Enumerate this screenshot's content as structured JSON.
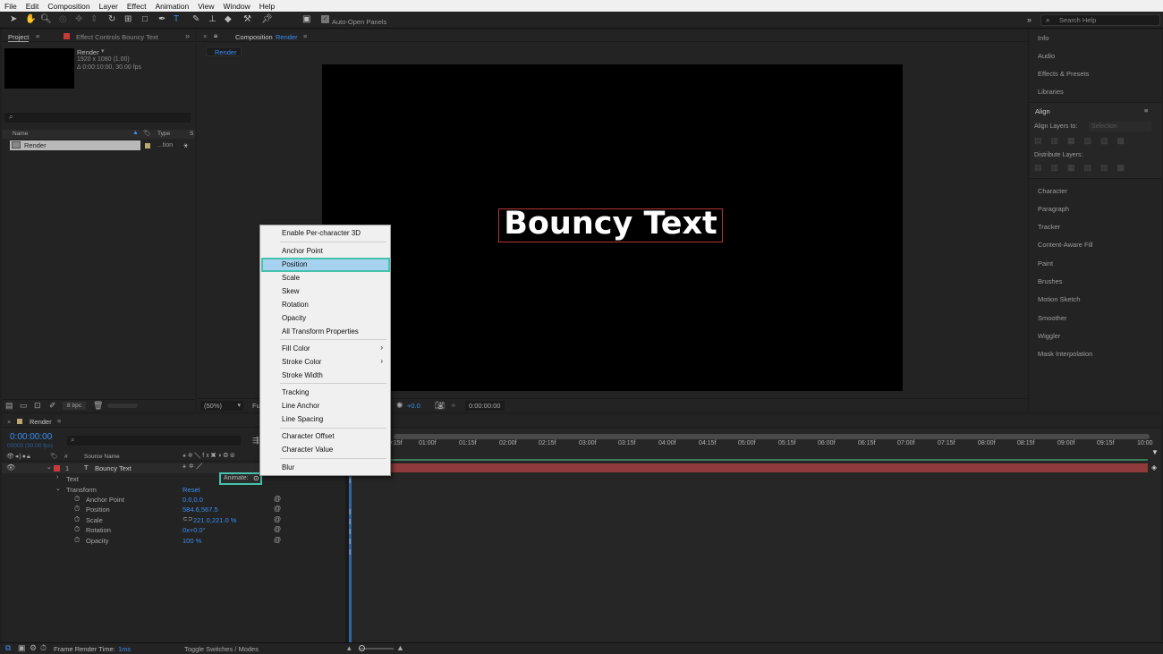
{
  "menubar": {
    "items": [
      "File",
      "Edit",
      "Composition",
      "Layer",
      "Effect",
      "Animation",
      "View",
      "Window",
      "Help"
    ]
  },
  "toolbar": {
    "auto_open_label": "Auto-Open Panels",
    "search_placeholder": "Search Help"
  },
  "project": {
    "tab_project": "Project",
    "tab_effect_controls": "Effect Controls Bouncy Text",
    "comp_name": "Render",
    "comp_res": "1920 x 1080 (1.00)",
    "comp_duration": "Δ 0:00:10:00, 30.00 fps",
    "col_name": "Name",
    "col_type": "Type",
    "item_name": "Render",
    "item_type": "...tion",
    "bpc": "8 bpc"
  },
  "viewer": {
    "tab_label": "Composition",
    "comp_name": "Render",
    "flow_tab": "Render",
    "canvas_text": "Bouncy Text",
    "zoom": "(50%)",
    "exposure": "+0.0",
    "timecode": "0:00:00:00"
  },
  "rightpanel": {
    "items": [
      "Info",
      "Audio",
      "Effects & Presets",
      "Libraries"
    ],
    "align_title": "Align",
    "align_layers_to": "Align Layers to:",
    "align_target": "Selection",
    "distribute": "Distribute Layers:",
    "items2": [
      "Character",
      "Paragraph",
      "Tracker",
      "Content-Aware Fill",
      "Paint",
      "Brushes",
      "Motion Sketch",
      "Smoother",
      "Wiggler",
      "Mask Interpolation"
    ]
  },
  "context_menu": {
    "items": [
      {
        "label": "Enable Per-character 3D",
        "sub": false
      },
      {
        "label": "Anchor Point",
        "sub": false
      },
      {
        "label": "Position",
        "sub": false
      },
      {
        "label": "Scale",
        "sub": false
      },
      {
        "label": "Skew",
        "sub": false
      },
      {
        "label": "Rotation",
        "sub": false
      },
      {
        "label": "Opacity",
        "sub": false
      },
      {
        "label": "All Transform Properties",
        "sub": false
      },
      {
        "label": "Fill Color",
        "sub": true
      },
      {
        "label": "Stroke Color",
        "sub": true
      },
      {
        "label": "Stroke Width",
        "sub": false
      },
      {
        "label": "Tracking",
        "sub": false
      },
      {
        "label": "Line Anchor",
        "sub": false
      },
      {
        "label": "Line Spacing",
        "sub": false
      },
      {
        "label": "Character Offset",
        "sub": false
      },
      {
        "label": "Character Value",
        "sub": false
      },
      {
        "label": "Blur",
        "sub": false
      }
    ],
    "highlighted": "Position"
  },
  "timeline": {
    "tab": "Render",
    "timecode": "0:00:00:00",
    "frames": "00000 (30.00 fps)",
    "col_source": "Source Name",
    "layer_num": "1",
    "layer_name": "Bouncy Text",
    "text_group": "Text",
    "animate_label": "Animate:",
    "transform_group": "Transform",
    "reset_label": "Reset",
    "props": [
      {
        "name": "Anchor Point",
        "value": "0.0,0.0"
      },
      {
        "name": "Position",
        "value": "584.6,567.5"
      },
      {
        "name": "Scale",
        "value": "221.0,221.0 %"
      },
      {
        "name": "Rotation",
        "value": "0x+0.0°"
      },
      {
        "name": "Opacity",
        "value": "100 %"
      }
    ],
    "ruler": [
      "0:15f",
      "01:00f",
      "01:15f",
      "02:00f",
      "02:15f",
      "03:00f",
      "03:15f",
      "04:00f",
      "04:15f",
      "05:00f",
      "05:15f",
      "06:00f",
      "06:15f",
      "07:00f",
      "07:15f",
      "08:00f",
      "08:15f",
      "09:00f",
      "09:15f",
      "10:00"
    ]
  },
  "status": {
    "render_time_label": "Frame Render Time:",
    "render_time_value": "1ms",
    "toggle": "Toggle Switches / Modes"
  },
  "colors": {
    "accent": "#3c8df0",
    "highlight": "#a6d2f0",
    "highlight_border": "#45c2ae",
    "layer_bar": "#8f3b3b",
    "label_red": "#c33b3b"
  }
}
